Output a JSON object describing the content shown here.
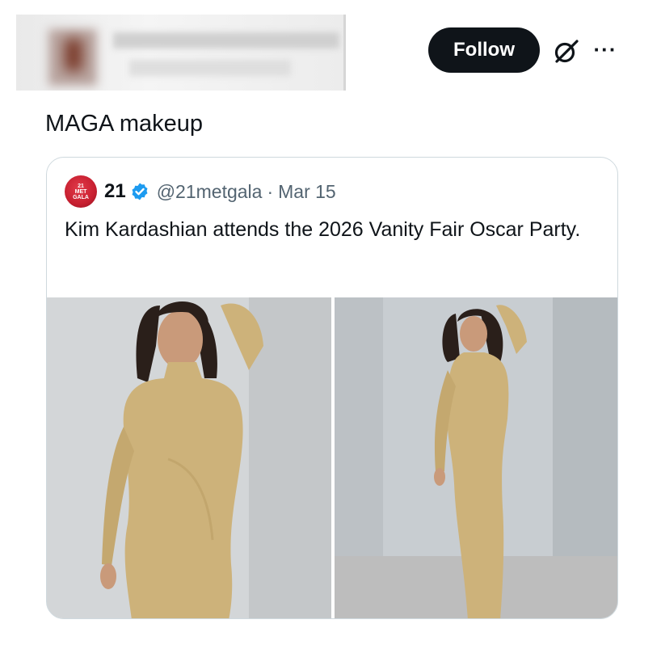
{
  "header": {
    "follow_label": "Follow",
    "icons": [
      "grok-icon",
      "more-icon"
    ]
  },
  "tweet": {
    "text": "MAGA makeup"
  },
  "quote": {
    "avatar_text": [
      "21",
      "MET",
      "GALA"
    ],
    "display_name": "21",
    "handle": "@21metgala",
    "separator": "·",
    "date": "Mar 15",
    "text": "Kim Kardashian attends the 2026 Vanity Fair Oscar Party."
  },
  "colors": {
    "follow_bg": "#0f1419",
    "verified": "#1d9bf0",
    "secondary_text": "#536471",
    "card_border": "#cfd9de",
    "dress_gold": "#cdb27a"
  }
}
